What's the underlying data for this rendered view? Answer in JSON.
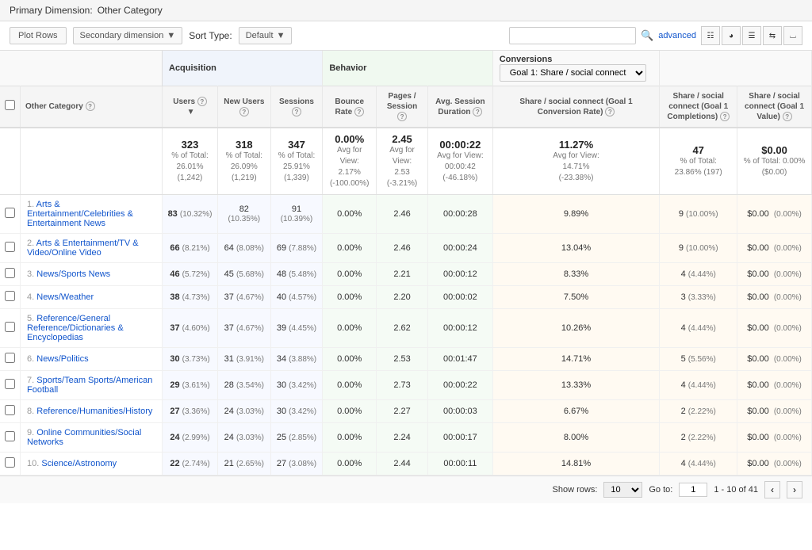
{
  "primary_dimension_label": "Primary Dimension:",
  "primary_dimension_value": "Other Category",
  "toolbar": {
    "plot_rows_label": "Plot Rows",
    "secondary_dimension_label": "Secondary dimension",
    "sort_type_label": "Sort Type:",
    "sort_type_value": "Default",
    "advanced_label": "advanced",
    "search_placeholder": ""
  },
  "goal_selector": "Goal 1: Share / social connect",
  "sections": {
    "acquisition": "Acquisition",
    "behavior": "Behavior",
    "conversions": "Conversions"
  },
  "columns": {
    "other_category": "Other Category",
    "users": "Users",
    "new_users": "New Users",
    "sessions": "Sessions",
    "bounce_rate": "Bounce Rate",
    "pages_session": "Pages / Session",
    "avg_session_duration": "Avg. Session Duration",
    "share_social_conv_rate": "Share / social connect (Goal 1 Conversion Rate)",
    "share_social_completions": "Share / social connect (Goal 1 Completions)",
    "share_social_value": "Share / social connect (Goal 1 Value)"
  },
  "summary": {
    "users": "323",
    "users_sub1": "% of Total:",
    "users_sub2": "26.01%",
    "users_sub3": "(1,242)",
    "new_users": "318",
    "new_users_sub1": "% of Total:",
    "new_users_sub2": "26.09%",
    "new_users_sub3": "(1,219)",
    "sessions": "347",
    "sessions_sub1": "% of Total:",
    "sessions_sub2": "25.91%",
    "sessions_sub3": "(1,339)",
    "bounce_rate": "0.00%",
    "bounce_rate_sub1": "Avg for View:",
    "bounce_rate_sub2": "2.17%",
    "bounce_rate_sub3": "(-100.00%)",
    "pages_session": "2.45",
    "pages_session_sub1": "Avg for View:",
    "pages_session_sub2": "2.53",
    "pages_session_sub3": "(-3.21%)",
    "avg_duration": "00:00:22",
    "avg_duration_sub1": "Avg for View:",
    "avg_duration_sub2": "00:00:42",
    "avg_duration_sub3": "(-46.18%)",
    "conv_rate": "11.27%",
    "conv_rate_sub1": "Avg for View:",
    "conv_rate_sub2": "14.71%",
    "conv_rate_sub3": "(-23.38%)",
    "completions": "47",
    "completions_sub1": "% of Total:",
    "completions_sub2": "23.86% (197)",
    "value": "$0.00",
    "value_sub1": "% of Total: 0.00%",
    "value_sub2": "($0.00)"
  },
  "rows": [
    {
      "num": "1.",
      "category": "Arts & Entertainment/Celebrities & Entertainment News",
      "users": "83",
      "users_pct": "(10.32%)",
      "new_users": "82",
      "new_users_pct": "(10.35%)",
      "sessions": "91",
      "sessions_pct": "(10.39%)",
      "bounce_rate": "0.00%",
      "pages_session": "2.46",
      "avg_duration": "00:00:28",
      "conv_rate": "9.89%",
      "completions": "9",
      "completions_pct": "(10.00%)",
      "value": "$0.00",
      "value_pct": "(0.00%)"
    },
    {
      "num": "2.",
      "category": "Arts & Entertainment/TV & Video/Online Video",
      "users": "66",
      "users_pct": "(8.21%)",
      "new_users": "64",
      "new_users_pct": "(8.08%)",
      "sessions": "69",
      "sessions_pct": "(7.88%)",
      "bounce_rate": "0.00%",
      "pages_session": "2.46",
      "avg_duration": "00:00:24",
      "conv_rate": "13.04%",
      "completions": "9",
      "completions_pct": "(10.00%)",
      "value": "$0.00",
      "value_pct": "(0.00%)"
    },
    {
      "num": "3.",
      "category": "News/Sports News",
      "users": "46",
      "users_pct": "(5.72%)",
      "new_users": "45",
      "new_users_pct": "(5.68%)",
      "sessions": "48",
      "sessions_pct": "(5.48%)",
      "bounce_rate": "0.00%",
      "pages_session": "2.21",
      "avg_duration": "00:00:12",
      "conv_rate": "8.33%",
      "completions": "4",
      "completions_pct": "(4.44%)",
      "value": "$0.00",
      "value_pct": "(0.00%)"
    },
    {
      "num": "4.",
      "category": "News/Weather",
      "users": "38",
      "users_pct": "(4.73%)",
      "new_users": "37",
      "new_users_pct": "(4.67%)",
      "sessions": "40",
      "sessions_pct": "(4.57%)",
      "bounce_rate": "0.00%",
      "pages_session": "2.20",
      "avg_duration": "00:00:02",
      "conv_rate": "7.50%",
      "completions": "3",
      "completions_pct": "(3.33%)",
      "value": "$0.00",
      "value_pct": "(0.00%)"
    },
    {
      "num": "5.",
      "category": "Reference/General Reference/Dictionaries & Encyclopedias",
      "users": "37",
      "users_pct": "(4.60%)",
      "new_users": "37",
      "new_users_pct": "(4.67%)",
      "sessions": "39",
      "sessions_pct": "(4.45%)",
      "bounce_rate": "0.00%",
      "pages_session": "2.62",
      "avg_duration": "00:00:12",
      "conv_rate": "10.26%",
      "completions": "4",
      "completions_pct": "(4.44%)",
      "value": "$0.00",
      "value_pct": "(0.00%)"
    },
    {
      "num": "6.",
      "category": "News/Politics",
      "users": "30",
      "users_pct": "(3.73%)",
      "new_users": "31",
      "new_users_pct": "(3.91%)",
      "sessions": "34",
      "sessions_pct": "(3.88%)",
      "bounce_rate": "0.00%",
      "pages_session": "2.53",
      "avg_duration": "00:01:47",
      "conv_rate": "14.71%",
      "completions": "5",
      "completions_pct": "(5.56%)",
      "value": "$0.00",
      "value_pct": "(0.00%)"
    },
    {
      "num": "7.",
      "category": "Sports/Team Sports/American Football",
      "users": "29",
      "users_pct": "(3.61%)",
      "new_users": "28",
      "new_users_pct": "(3.54%)",
      "sessions": "30",
      "sessions_pct": "(3.42%)",
      "bounce_rate": "0.00%",
      "pages_session": "2.73",
      "avg_duration": "00:00:22",
      "conv_rate": "13.33%",
      "completions": "4",
      "completions_pct": "(4.44%)",
      "value": "$0.00",
      "value_pct": "(0.00%)"
    },
    {
      "num": "8.",
      "category": "Reference/Humanities/History",
      "users": "27",
      "users_pct": "(3.36%)",
      "new_users": "24",
      "new_users_pct": "(3.03%)",
      "sessions": "30",
      "sessions_pct": "(3.42%)",
      "bounce_rate": "0.00%",
      "pages_session": "2.27",
      "avg_duration": "00:00:03",
      "conv_rate": "6.67%",
      "completions": "2",
      "completions_pct": "(2.22%)",
      "value": "$0.00",
      "value_pct": "(0.00%)"
    },
    {
      "num": "9.",
      "category": "Online Communities/Social Networks",
      "users": "24",
      "users_pct": "(2.99%)",
      "new_users": "24",
      "new_users_pct": "(3.03%)",
      "sessions": "25",
      "sessions_pct": "(2.85%)",
      "bounce_rate": "0.00%",
      "pages_session": "2.24",
      "avg_duration": "00:00:17",
      "conv_rate": "8.00%",
      "completions": "2",
      "completions_pct": "(2.22%)",
      "value": "$0.00",
      "value_pct": "(0.00%)"
    },
    {
      "num": "10.",
      "category": "Science/Astronomy",
      "users": "22",
      "users_pct": "(2.74%)",
      "new_users": "21",
      "new_users_pct": "(2.65%)",
      "sessions": "27",
      "sessions_pct": "(3.08%)",
      "bounce_rate": "0.00%",
      "pages_session": "2.44",
      "avg_duration": "00:00:11",
      "conv_rate": "14.81%",
      "completions": "4",
      "completions_pct": "(4.44%)",
      "value": "$0.00",
      "value_pct": "(0.00%)"
    }
  ],
  "footer": {
    "show_rows_label": "Show rows:",
    "show_rows_value": "10",
    "go_to_label": "Go to:",
    "go_to_value": "1",
    "range_label": "1 - 10 of 41"
  }
}
